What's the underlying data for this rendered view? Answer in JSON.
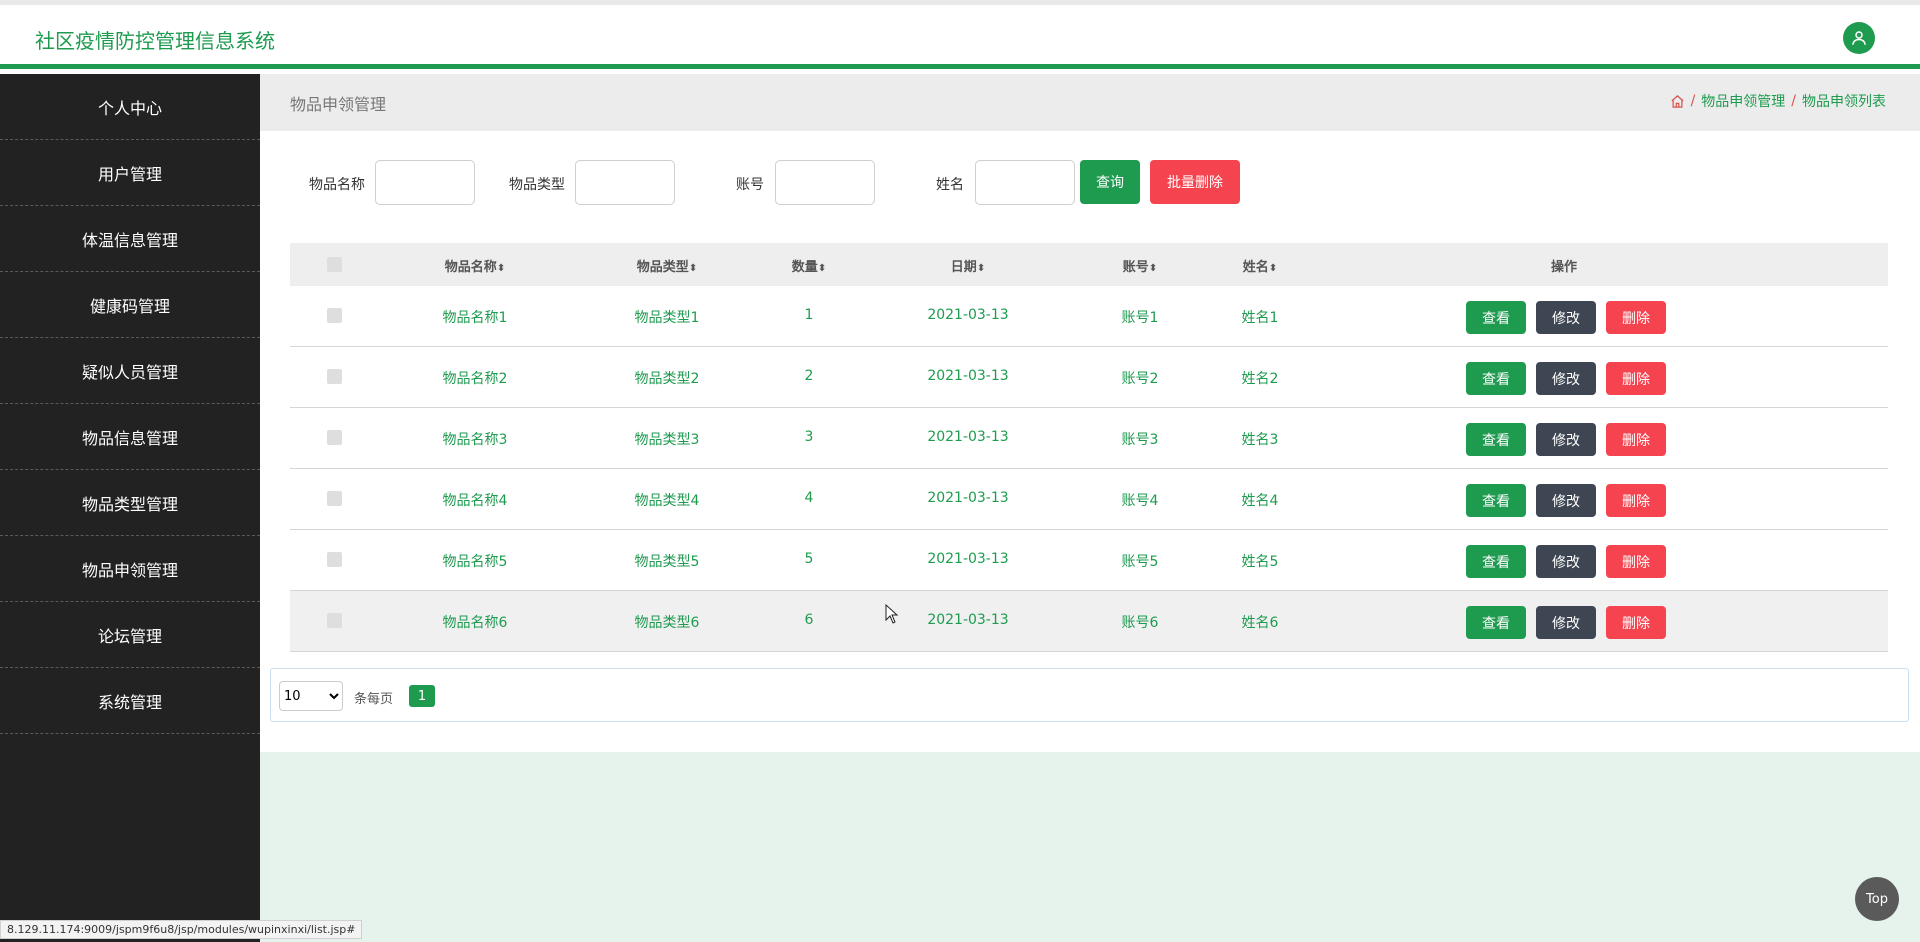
{
  "header": {
    "title": "社区疫情防控管理信息系统"
  },
  "sidebar": {
    "items": [
      {
        "label": "个人中心"
      },
      {
        "label": "用户管理"
      },
      {
        "label": "体温信息管理"
      },
      {
        "label": "健康码管理"
      },
      {
        "label": "疑似人员管理"
      },
      {
        "label": "物品信息管理"
      },
      {
        "label": "物品类型管理"
      },
      {
        "label": "物品申领管理"
      },
      {
        "label": "论坛管理"
      },
      {
        "label": "系统管理"
      }
    ]
  },
  "page": {
    "title": "物品申领管理",
    "breadcrumb": {
      "level1": "物品申领管理",
      "sep": "/",
      "level2": "物品申领列表"
    }
  },
  "search": {
    "fields": [
      {
        "label": "物品名称",
        "value": ""
      },
      {
        "label": "物品类型",
        "value": ""
      },
      {
        "label": "账号",
        "value": ""
      },
      {
        "label": "姓名",
        "value": ""
      }
    ],
    "query_label": "查询",
    "batch_delete_label": "批量删除"
  },
  "table": {
    "columns": [
      "物品名称",
      "物品类型",
      "数量",
      "日期",
      "账号",
      "姓名",
      "操作"
    ],
    "sort_glyph": "⬍",
    "rows": [
      {
        "name": "物品名称1",
        "type": "物品类型1",
        "qty": "1",
        "date": "2021-03-13",
        "account": "账号1",
        "person": "姓名1"
      },
      {
        "name": "物品名称2",
        "type": "物品类型2",
        "qty": "2",
        "date": "2021-03-13",
        "account": "账号2",
        "person": "姓名2"
      },
      {
        "name": "物品名称3",
        "type": "物品类型3",
        "qty": "3",
        "date": "2021-03-13",
        "account": "账号3",
        "person": "姓名3"
      },
      {
        "name": "物品名称4",
        "type": "物品类型4",
        "qty": "4",
        "date": "2021-03-13",
        "account": "账号4",
        "person": "姓名4"
      },
      {
        "name": "物品名称5",
        "type": "物品类型5",
        "qty": "5",
        "date": "2021-03-13",
        "account": "账号5",
        "person": "姓名5"
      },
      {
        "name": "物品名称6",
        "type": "物品类型6",
        "qty": "6",
        "date": "2021-03-13",
        "account": "账号6",
        "person": "姓名6"
      }
    ],
    "actions": {
      "view": "查看",
      "edit": "修改",
      "delete": "删除"
    }
  },
  "pager": {
    "page_size": "10",
    "page_size_options": [
      "10"
    ],
    "per_page_label": "条每页",
    "current_page": "1"
  },
  "top_button": "Top",
  "status_url": "8.129.11.174:9009/jspm9f6u8/jsp/modules/wupinxinxi/list.jsp#",
  "colors": {
    "accent": "#1e9b4f",
    "danger": "#f5434f",
    "dark": "#3f4653",
    "sidebar": "#222222"
  }
}
